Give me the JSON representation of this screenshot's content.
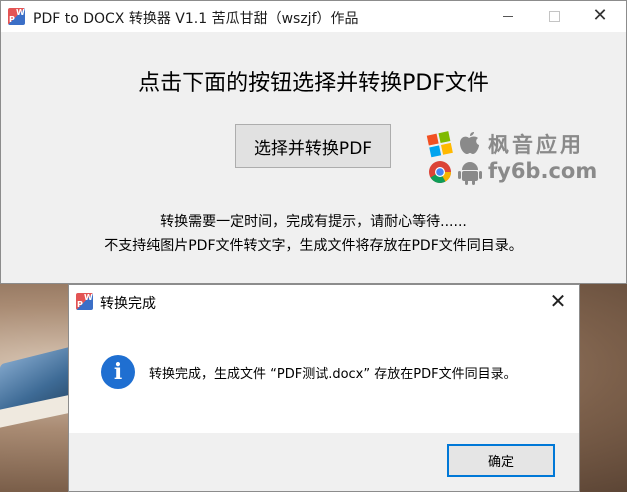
{
  "main_window": {
    "title": "PDF to DOCX 转换器 V1.1 苦瓜甘甜（wszjf）作品",
    "app_icon_letters": {
      "p": "P",
      "w": "W"
    },
    "controls": {
      "minimize": "minimize-icon",
      "maximize": "maximize-icon",
      "close": "✕"
    },
    "heading": "点击下面的按钮选择并转换PDF文件",
    "select_button_label": "选择并转换PDF",
    "hint_line_1": "转换需要一定时间，完成有提示，请耐心等待......",
    "hint_line_2": "不支持纯图片PDF文件转文字，生成文件将存放在PDF文件同目录。"
  },
  "watermark": {
    "line_1": "枫音应用",
    "line_2": "fy6b.com",
    "icons": [
      "windows-logo-icon",
      "apple-logo-icon",
      "chrome-logo-icon",
      "android-logo-icon"
    ],
    "colors": {
      "win_red": "#f25022",
      "win_green": "#7fba00",
      "win_blue": "#00a4ef",
      "win_yellow": "#ffb900",
      "gray": "#8a8a8a"
    }
  },
  "dialog": {
    "title": "转换完成",
    "close_glyph": "✕",
    "info_glyph": "i",
    "message": "转换完成，生成文件 “PDF测试.docx” 存放在PDF文件同目录。",
    "ok_button_label": "确定"
  },
  "colors": {
    "accent": "#0078d7",
    "info": "#1f6fd1",
    "window_bg": "#f0f0f0"
  }
}
